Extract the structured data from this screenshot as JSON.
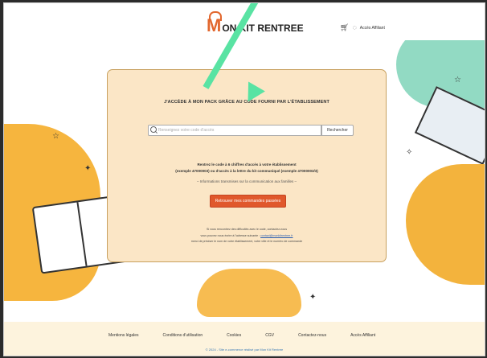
{
  "header": {
    "logo_m": "M",
    "logo_text": "ON KIT RENTREE",
    "cart_icon": "cart-icon",
    "user_icon": "user-icon",
    "pro_link": "Accès Affiliant"
  },
  "card": {
    "title": "J'ACCÈDE À MON PACK GRÂCE AU CODE FOURNI PAR L'ÉTABLISSEMENT",
    "search_placeholder": "Renseignez votre code d'accès",
    "search_button": "Rechercher",
    "instruction_1": "Rentrez le code à 6 chiffres d'accès à votre établissement",
    "instruction_2": "(exemple 47000003) ou d'accès à la lettre du kit communiqué (exemple 47000003/3)",
    "instruction_3": "– Informations transmises sur la communication aux familles –",
    "retrieve_button": "Retrouver mes commandes passées",
    "small_1": "Si vous rencontrez des difficultés avec le code, contactez-nous",
    "small_2_prefix": "vous pouvez nous écrire à l'adresse suivante :",
    "small_2_link": "contact@monkitrentree.fr",
    "small_3": "merci de préciser le nom de votre établissement, votre ville et le numéro de commande"
  },
  "footer": {
    "links": [
      "Mentions légales",
      "Conditions d'utilisation",
      "Cookies",
      "CGV",
      "Contactez-nous",
      "Accès Affiliant"
    ],
    "copyright": "© 2024 - Site e-commerce réalisé par Mon Kit Rentree"
  },
  "colors": {
    "accent": "#e0582c",
    "card_bg": "#fbe6c6",
    "arrow": "#59e3a3",
    "yellow_blob": "#f6b53e",
    "green_blob": "#7fd3b9"
  }
}
